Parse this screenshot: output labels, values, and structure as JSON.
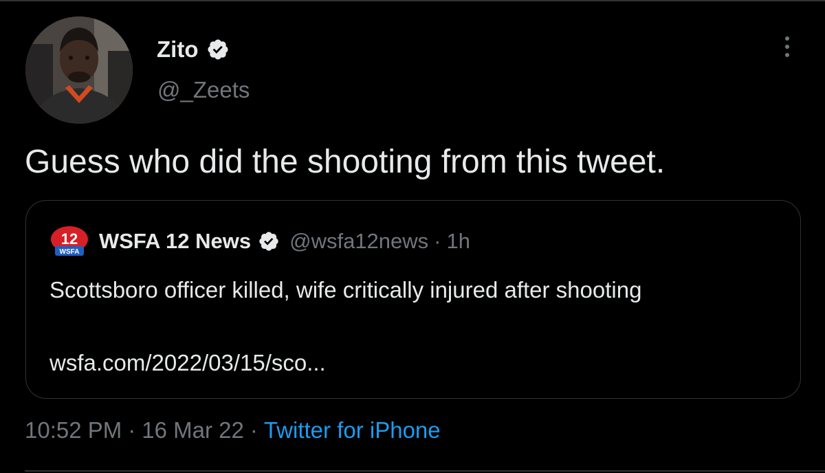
{
  "tweet": {
    "author": {
      "display_name": "Zito",
      "handle": "@_Zeets",
      "verified": true,
      "avatar_icon": "profile-photo"
    },
    "text": "Guess who did the shooting from this tweet.",
    "more_icon": "more-horizontal-icon"
  },
  "quoted_tweet": {
    "logo": {
      "number": "12",
      "label": "WSFA"
    },
    "display_name": "WSFA 12 News",
    "verified": true,
    "handle": "@wsfa12news",
    "separator": "·",
    "time_ago": "1h",
    "text": "Scottsboro officer killed, wife critically injured after shooting",
    "link": "wsfa.com/2022/03/15/sco..."
  },
  "meta": {
    "time": "10:52 PM",
    "separator": "·",
    "date": "16 Mar 22",
    "source": "Twitter for iPhone"
  },
  "colors": {
    "background": "#000000",
    "primary_text": "#e7e9ea",
    "secondary_text": "#71767b",
    "accent": "#1d9bf0",
    "border": "#2f3336",
    "wsfa_red": "#d62027",
    "wsfa_blue": "#1f5fbf"
  }
}
